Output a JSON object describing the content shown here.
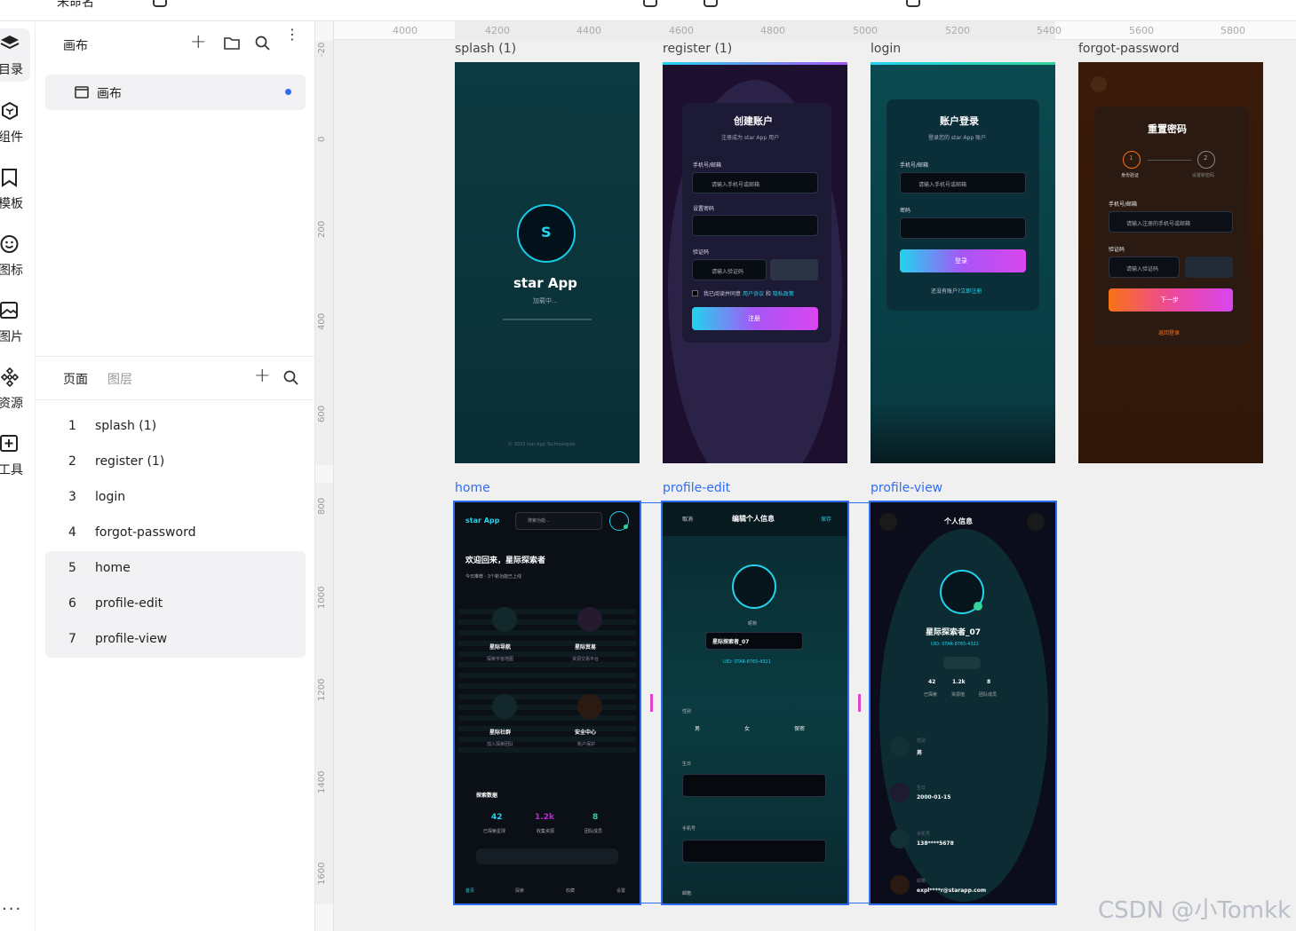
{
  "topbar": {
    "title": "未命名"
  },
  "rail": [
    {
      "label": "目录",
      "icon": "layers-icon"
    },
    {
      "label": "组件",
      "icon": "component-icon"
    },
    {
      "label": "模板",
      "icon": "bookmark-icon"
    },
    {
      "label": "图标",
      "icon": "smiley-icon"
    },
    {
      "label": "图片",
      "icon": "image-icon"
    },
    {
      "label": "资源",
      "icon": "resource-icon"
    },
    {
      "label": "工具",
      "icon": "tool-plus-icon"
    }
  ],
  "panel": {
    "header_title": "画布",
    "canvas_item": "画布",
    "tabs": {
      "pages": "页面",
      "layers": "图层"
    },
    "pages": [
      {
        "num": "1",
        "name": "splash (1)"
      },
      {
        "num": "2",
        "name": "register (1)"
      },
      {
        "num": "3",
        "name": "login"
      },
      {
        "num": "4",
        "name": "forgot-password"
      },
      {
        "num": "5",
        "name": "home"
      },
      {
        "num": "6",
        "name": "profile-edit"
      },
      {
        "num": "7",
        "name": "profile-view"
      }
    ]
  },
  "rulers": {
    "h": [
      "4000",
      "4200",
      "4400",
      "4600",
      "4800",
      "5000",
      "5200",
      "5400",
      "5600",
      "5800"
    ],
    "v": [
      "-20",
      "0",
      "200",
      "400",
      "600",
      "800",
      "1000",
      "1200",
      "1400",
      "1600"
    ]
  },
  "frames": {
    "splash": {
      "label": "splash (1)",
      "logo": "S",
      "app": "star App",
      "loading": "加载中...",
      "footer": "© 2023 star App Technologies"
    },
    "register": {
      "label": "register (1)",
      "title": "创建账户",
      "subtitle": "注册成为 star App 用户",
      "phone_label": "手机号/邮箱",
      "phone_ph": "请输入手机号或邮箱",
      "pwd_label": "设置密码",
      "code_label": "验证码",
      "code_ph": "请输入验证码",
      "agree": "我已阅读并同意",
      "terms": "用户协议",
      "and": "和",
      "privacy": "隐私政策",
      "btn": "注册"
    },
    "login": {
      "label": "login",
      "title": "账户登录",
      "subtitle": "登录您的 star App 账户",
      "phone_label": "手机号/邮箱",
      "phone_ph": "请输入手机号或邮箱",
      "pwd_label": "密码",
      "btn": "登录",
      "no_account": "还没有账户?",
      "signup": "立即注册"
    },
    "forgot": {
      "label": "forgot-password",
      "title": "重置密码",
      "step1": "1",
      "step1_label": "身份验证",
      "step2": "2",
      "step2_label": "设置新密码",
      "phone_label": "手机号/邮箱",
      "phone_ph": "请输入注册的手机号或邮箱",
      "code_label": "验证码",
      "code_ph": "请输入验证码",
      "btn": "下一步",
      "back": "返回登录"
    },
    "home": {
      "label": "home",
      "app": "star App",
      "search_ph": "搜索功能...",
      "welcome": "欢迎回来，星际探索者",
      "sub": "今日推荐 · 3个新功能已上线",
      "cards": [
        {
          "title": "星际导航",
          "sub": "探索宇宙地图"
        },
        {
          "title": "星际贸易",
          "sub": "资源交易平台"
        },
        {
          "title": "星际社群",
          "sub": "加入探索团队"
        },
        {
          "title": "安全中心",
          "sub": "账户保护"
        }
      ],
      "stats_title": "探索数据",
      "stats": [
        {
          "value": "42",
          "label": "已探索星球",
          "color": "#22d3ee"
        },
        {
          "value": "1.2k",
          "label": "收集资源",
          "color": "#c026d3"
        },
        {
          "value": "8",
          "label": "团队成员",
          "color": "#34d399"
        }
      ],
      "nav": [
        "首页",
        "探索",
        "收藏",
        "设置"
      ]
    },
    "profile_edit": {
      "label": "profile-edit",
      "cancel": "取消",
      "title": "编辑个人信息",
      "save": "保存",
      "nick_label": "昵称",
      "nick": "星际探索者_07",
      "uid": "UID: STAR-8765-4321",
      "gender_label": "性别",
      "genders": [
        "男",
        "女",
        "保密"
      ],
      "birth_label": "生日",
      "phone_label": "手机号",
      "email_label": "邮箱"
    },
    "profile_view": {
      "label": "profile-view",
      "title": "个人信息",
      "name": "星际探索者_07",
      "uid": "UID: STAR-8765-4321",
      "stats": [
        {
          "value": "42",
          "label": "已探索"
        },
        {
          "value": "1.2k",
          "label": "资源值"
        },
        {
          "value": "8",
          "label": "团队成员"
        }
      ],
      "gender_label": "性别",
      "gender": "男",
      "birth_label": "生日",
      "birth": "2000-01-15",
      "phone_label": "手机号",
      "phone": "138****5678",
      "email_label": "邮箱",
      "email": "expl****r@starapp.com"
    }
  },
  "watermark": "CSDN @小Tomkk"
}
